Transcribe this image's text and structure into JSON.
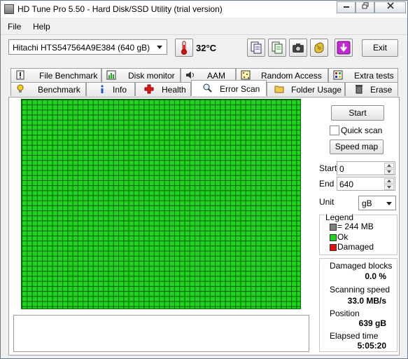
{
  "window": {
    "title": "HD Tune Pro 5.50 - Hard Disk/SSD Utility (trial version)"
  },
  "menu": {
    "file": "File",
    "help": "Help"
  },
  "toolbar": {
    "drive": "Hitachi HTS547564A9E384 (640 gB)",
    "temperature": "32°C",
    "exit_label": "Exit"
  },
  "tabs_top": [
    {
      "label": "File Benchmark",
      "icon": "file-benchmark-icon"
    },
    {
      "label": "Disk monitor",
      "icon": "disk-monitor-icon"
    },
    {
      "label": "AAM",
      "icon": "speaker-icon"
    },
    {
      "label": "Random Access",
      "icon": "random-access-icon"
    },
    {
      "label": "Extra tests",
      "icon": "extra-tests-icon"
    }
  ],
  "tabs_bottom": [
    {
      "label": "Benchmark",
      "icon": "lightbulb-icon"
    },
    {
      "label": "Info",
      "icon": "info-icon"
    },
    {
      "label": "Health",
      "icon": "health-cross-icon"
    },
    {
      "label": "Error Scan",
      "icon": "magnifier-icon",
      "active": true
    },
    {
      "label": "Folder Usage",
      "icon": "folder-icon"
    },
    {
      "label": "Erase",
      "icon": "trash-icon"
    }
  ],
  "controls": {
    "start_button": "Start",
    "quick_scan": "Quick scan",
    "quick_scan_checked": false,
    "speed_map_button": "Speed map",
    "start_label": "Start",
    "start_value": "0",
    "end_label": "End",
    "end_value": "640",
    "unit_label": "Unit",
    "unit_value": "gB"
  },
  "legend": {
    "title": "Legend",
    "block_size": "= 244 MB",
    "ok": "Ok",
    "damaged": "Damaged",
    "colors": {
      "block": "#808080",
      "ok": "#1fd31f",
      "damaged": "#e01010"
    }
  },
  "stats": {
    "damaged_blocks_label": "Damaged blocks",
    "damaged_blocks_value": "0.0 %",
    "scanning_speed_label": "Scanning speed",
    "scanning_speed_value": "33.0 MB/s",
    "position_label": "Position",
    "position_value": "639 gB",
    "elapsed_label": "Elapsed time",
    "elapsed_value": "5:05:20"
  },
  "scan_map": {
    "status": "all blocks ok",
    "color": "#1fd31f"
  }
}
